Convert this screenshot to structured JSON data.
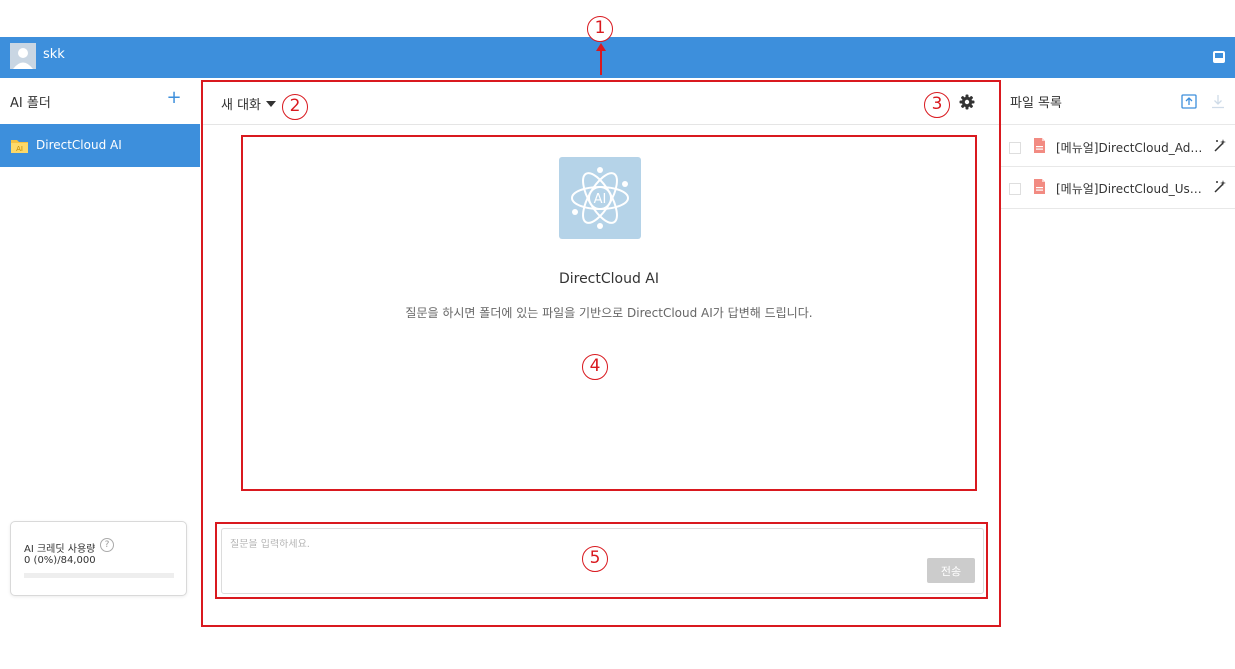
{
  "header": {
    "username": "skk"
  },
  "sidebar": {
    "title": "AI 폴더",
    "add_label": "+",
    "folders": [
      {
        "label": "DirectCloud AI"
      }
    ],
    "folder_icon_text": "AI",
    "credit": {
      "title": "AI 크레딧 사용량",
      "help": "?",
      "value": "0 (0%)/84,000",
      "usage_percent": 0
    }
  },
  "conversation": {
    "title": "새 대화",
    "assistant_name": "DirectCloud AI",
    "logo_text": "AI",
    "description": "질문을 하시면 폴더에 있는 파일을 기반으로 DirectCloud AI가 답변해 드립니다.",
    "input_placeholder": "질문을 입력하세요.",
    "input_value": "",
    "send_label": "전송"
  },
  "files": {
    "title": "파일 목록",
    "items": [
      {
        "name": "[메뉴얼]DirectCloud_Admin_manual.pdf"
      },
      {
        "name": "[메뉴얼]DirectCloud_User_manual.pdf"
      }
    ]
  },
  "annotations": {
    "markers": [
      "1",
      "2",
      "3",
      "4",
      "5"
    ],
    "color": "#d9191f"
  },
  "colors": {
    "brand": "#3d8fdc",
    "annotation": "#d9191f"
  }
}
